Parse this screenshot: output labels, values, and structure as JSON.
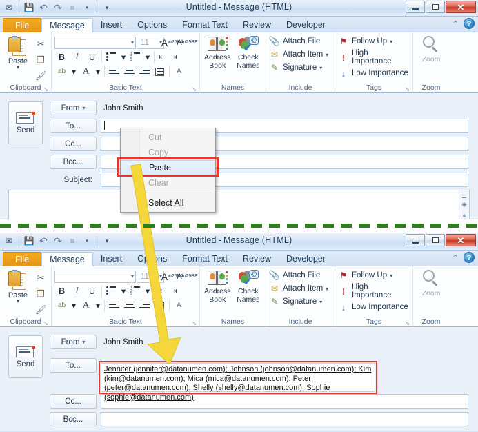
{
  "window": {
    "title_main": "Untitled",
    "title_sep": "-",
    "title_doc": "Message (HTML)",
    "minimize_label": "–",
    "maximize_label": "□",
    "close_label": "✕"
  },
  "quick_access": [
    {
      "name": "outlook-item-icon",
      "glyph": "✉"
    },
    {
      "name": "save-icon",
      "glyph": "💾"
    },
    {
      "name": "undo-icon",
      "glyph": "↶"
    },
    {
      "name": "redo-icon",
      "glyph": "↷"
    },
    {
      "name": "print-preview-icon",
      "glyph": "≡"
    },
    {
      "name": "customize-qat-icon",
      "glyph": "▾"
    }
  ],
  "tabs": [
    {
      "label": "File",
      "active": false,
      "file": true
    },
    {
      "label": "Message",
      "active": true
    },
    {
      "label": "Insert",
      "active": false
    },
    {
      "label": "Options",
      "active": false
    },
    {
      "label": "Format Text",
      "active": false
    },
    {
      "label": "Review",
      "active": false
    },
    {
      "label": "Developer",
      "active": false
    }
  ],
  "tabrow_right": {
    "collapse_ribbon": "⌃",
    "help": "?"
  },
  "ribbon": {
    "clipboard": {
      "group_label": "Clipboard",
      "paste_label": "Paste",
      "paste_arrow": "▾",
      "cut_glyph": "✂",
      "copy_glyph": "❐",
      "format_painter_glyph": "🖌",
      "dialog_launcher": "↘"
    },
    "basic_text": {
      "group_label": "Basic Text",
      "font_name": "",
      "font_size": "11",
      "grow_font": "A",
      "shrink_font": "A",
      "bold": "B",
      "italic": "I",
      "underline": "U",
      "highlight": "ab",
      "font_color": "A",
      "bullets": "•",
      "numbering": "1.",
      "decrease_indent": "⇤",
      "increase_indent": "⇥",
      "align_left": "≡",
      "align_center": "≡",
      "align_right": "≡",
      "justify": "≡",
      "clear_formatting": "A",
      "dropdown_caret": "▾",
      "dialog_launcher": "↘"
    },
    "names": {
      "group_label": "Names",
      "address_book_label_1": "Address",
      "address_book_label_2": "Book",
      "check_names_label_1": "Check",
      "check_names_label_2": "Names",
      "at_glyph": "@",
      "check_glyph": "✔"
    },
    "include": {
      "group_label": "Include",
      "items": [
        {
          "label": "Attach File",
          "icon": "paperclip-icon",
          "glyph": "📎",
          "caret": ""
        },
        {
          "label": "Attach Item",
          "icon": "attach-item-icon",
          "glyph": "✉",
          "caret": "▾"
        },
        {
          "label": "Signature",
          "icon": "signature-icon",
          "glyph": "✎",
          "caret": "▾"
        }
      ]
    },
    "tags": {
      "group_label": "Tags",
      "items": [
        {
          "label": "Follow Up",
          "icon": "flag-icon",
          "glyph": "⚑",
          "caret": "▾"
        },
        {
          "label": "High Importance",
          "icon": "exclamation-icon",
          "glyph": "!",
          "caret": ""
        },
        {
          "label": "Low Importance",
          "icon": "down-arrow-icon",
          "glyph": "↓",
          "caret": ""
        }
      ],
      "dialog_launcher": "↘"
    },
    "zoom": {
      "group_label": "Zoom",
      "button_label": "Zoom"
    }
  },
  "compose": {
    "send_label": "Send",
    "from_button": "From",
    "from_caret": "▾",
    "from_value": "John Smith",
    "to_button": "To...",
    "cc_button": "Cc...",
    "bcc_button": "Bcc...",
    "subject_label": "Subject:",
    "to_value_top": "",
    "cc_value": "",
    "bcc_value": "",
    "subject_value": "",
    "body_value": ""
  },
  "recipients": {
    "line1": "Jennifer (jennifer@datanumen.com); Johnson (johnson@datanumen.com); Kim (kim@datanumen.com);",
    "line2": "Mica (mica@datanumen.com); Peter (peter@datanumen.com); Shelly (shelly@datanumen.com);",
    "line3": "Sophie (sophie@datanumen.com)",
    "entries": [
      "Jennifer (jennifer@datanumen.com)",
      "Johnson (johnson@datanumen.com)",
      "Kim (kim@datanumen.com)",
      "Mica (mica@datanumen.com)",
      "Peter (peter@datanumen.com)",
      "Shelly (shelly@datanumen.com)",
      "Sophie (sophie@datanumen.com)"
    ]
  },
  "context_menu": {
    "items": [
      {
        "label": "Cut",
        "state": "disabled"
      },
      {
        "label": "Copy",
        "state": "disabled"
      },
      {
        "label": "Paste",
        "state": "highlight"
      },
      {
        "label": "Clear",
        "state": "disabled"
      },
      {
        "label": "Select All",
        "state": "normal"
      }
    ]
  },
  "scrollbar": {
    "up_arrow": "▲",
    "down_arrow": "▼",
    "browse_object": "◈",
    "top_mark": "▁"
  },
  "annotations": {
    "highlight_color": "#e8372a",
    "arrow_color": "#f5d73c",
    "divider_color": "#2f7d1e"
  }
}
